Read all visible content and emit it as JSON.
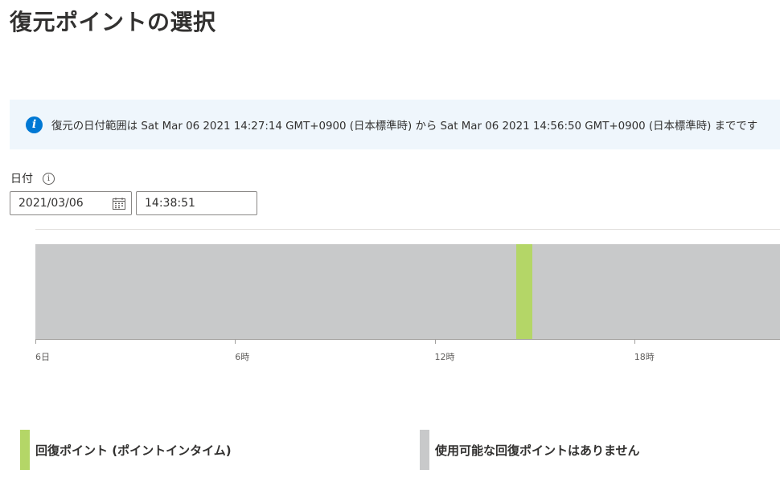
{
  "page": {
    "title": "復元ポイントの選択"
  },
  "info_bar": {
    "icon": "info-icon",
    "text": "復元の日付範囲は Sat Mar 06 2021 14:27:14 GMT+0900 (日本標準時) から Sat Mar 06 2021 14:56:50 GMT+0900 (日本標準時) までです",
    "accent_color": "#0078d4"
  },
  "date_picker": {
    "label": "日付",
    "help_icon": "info-circle-icon",
    "date_value": "2021/03/06",
    "time_value": "14:38:51",
    "calendar_icon": "calendar-icon"
  },
  "timeline": {
    "tick_labels": [
      "6日",
      "6時",
      "12時",
      "18時"
    ],
    "available_range_start": "14:27:14",
    "available_range_end": "14:56:50",
    "unavailable_color": "#c8c9ca",
    "restore_point_color": "#b4d667"
  },
  "legend": {
    "items": [
      {
        "label": "回復ポイント (ポイントインタイム)",
        "color": "#b4d667"
      },
      {
        "label": "使用可能な回復ポイントはありません",
        "color": "#c8c9ca"
      }
    ]
  }
}
